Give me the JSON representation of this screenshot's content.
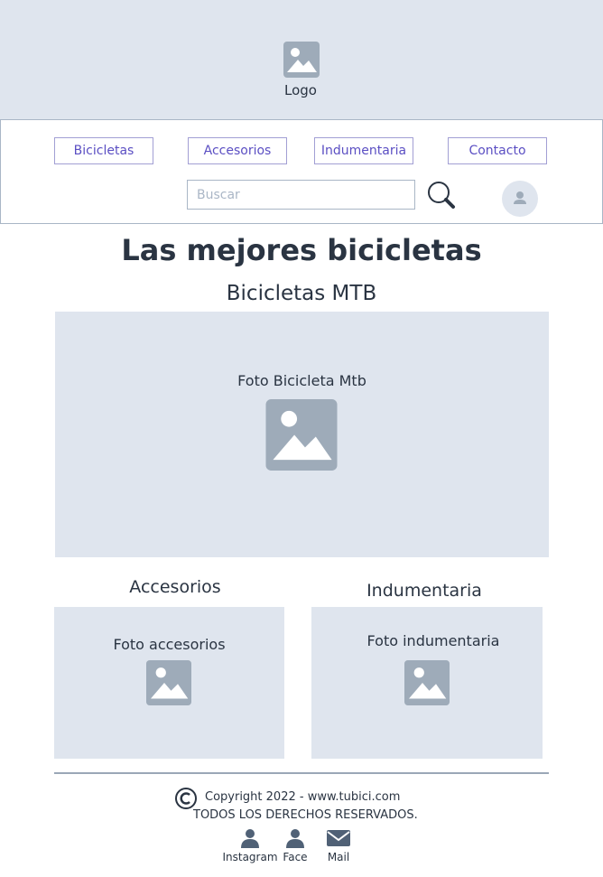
{
  "header": {
    "logo_label": "Logo"
  },
  "nav": {
    "items": [
      {
        "label": "Bicicletas"
      },
      {
        "label": "Accesorios"
      },
      {
        "label": "Indumentaria"
      },
      {
        "label": "Contacto"
      }
    ],
    "search_placeholder": "Buscar"
  },
  "main": {
    "title": "Las mejores bicicletas",
    "mtb_title": "Bicicletas MTB",
    "mtb_caption": "Foto Bicicleta Mtb",
    "accesorios_title": "Accesorios",
    "accesorios_caption": "Foto accesorios",
    "indumentaria_title": "Indumentaria",
    "indumentaria_caption": "Foto indumentaria"
  },
  "footer": {
    "copyright": "Copyright 2022 - www.tubici.com",
    "rights": "TODOS LOS DERECHOS RESERVADOS.",
    "social": [
      {
        "label": "Instagram",
        "icon": "person-icon"
      },
      {
        "label": "Face",
        "icon": "person-icon"
      },
      {
        "label": "Mail",
        "icon": "mail-icon"
      }
    ]
  },
  "colors": {
    "header_bg": "#dfe5ee",
    "panel_bg": "#dfe5ee",
    "nav_text": "#5b4fc3",
    "icon_gray": "#9eabb9",
    "text_dark": "#2a3442"
  }
}
